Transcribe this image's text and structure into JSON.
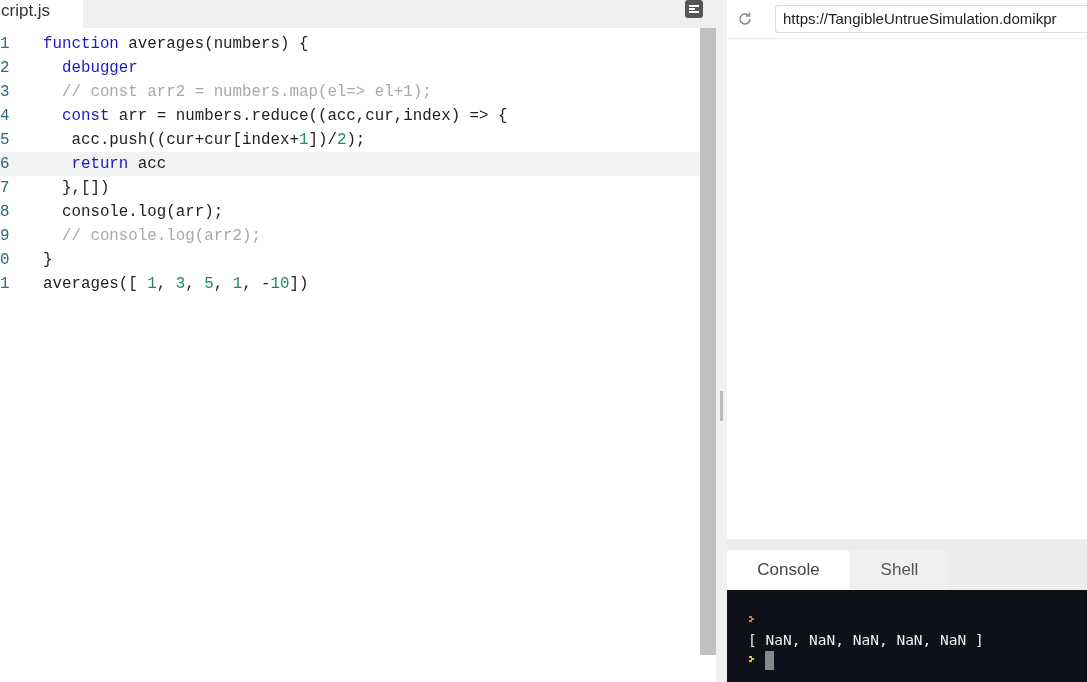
{
  "editor": {
    "tab": {
      "label": "cript.js",
      "selected": true
    },
    "lines": [
      {
        "number": "1",
        "selected": false,
        "tokens": [
          {
            "kind": "keyword",
            "text": "function"
          },
          {
            "kind": "plain",
            "text": " averages(numbers) {"
          }
        ]
      },
      {
        "number": "2",
        "selected": false,
        "tokens": [
          {
            "kind": "keyword",
            "text": "  debugger"
          }
        ]
      },
      {
        "number": "3",
        "selected": false,
        "tokens": [
          {
            "kind": "comment",
            "text": "  // const arr2 = numbers.map(el=> el+1);"
          }
        ]
      },
      {
        "number": "4",
        "selected": false,
        "tokens": [
          {
            "kind": "keyword",
            "text": "  const"
          },
          {
            "kind": "plain",
            "text": " arr = numbers.reduce((acc,cur,index) => {"
          }
        ]
      },
      {
        "number": "5",
        "selected": false,
        "tokens": [
          {
            "kind": "plain",
            "text": "   acc.push((cur+cur[index+"
          },
          {
            "kind": "number",
            "text": "1"
          },
          {
            "kind": "plain",
            "text": "])/"
          },
          {
            "kind": "number",
            "text": "2"
          },
          {
            "kind": "plain",
            "text": ");"
          }
        ]
      },
      {
        "number": "6",
        "selected": true,
        "tokens": [
          {
            "kind": "keyword",
            "text": "   return"
          },
          {
            "kind": "plain",
            "text": " acc"
          }
        ]
      },
      {
        "number": "7",
        "selected": false,
        "tokens": [
          {
            "kind": "plain",
            "text": "  },[])"
          }
        ]
      },
      {
        "number": "8",
        "selected": false,
        "tokens": [
          {
            "kind": "plain",
            "text": "  console.log(arr);"
          }
        ]
      },
      {
        "number": "9",
        "selected": false,
        "tokens": [
          {
            "kind": "comment",
            "text": "  // console.log(arr2);"
          }
        ]
      },
      {
        "number": "0",
        "selected": false,
        "tokens": [
          {
            "kind": "plain",
            "text": "}"
          }
        ]
      },
      {
        "number": "1",
        "selected": false,
        "tokens": [
          {
            "kind": "plain",
            "text": "averages([ "
          },
          {
            "kind": "number",
            "text": "1"
          },
          {
            "kind": "plain",
            "text": ", "
          },
          {
            "kind": "number",
            "text": "3"
          },
          {
            "kind": "plain",
            "text": ", "
          },
          {
            "kind": "number",
            "text": "5"
          },
          {
            "kind": "plain",
            "text": ", "
          },
          {
            "kind": "number",
            "text": "1"
          },
          {
            "kind": "plain",
            "text": ", -"
          },
          {
            "kind": "number",
            "text": "10"
          },
          {
            "kind": "plain",
            "text": "])"
          }
        ]
      }
    ]
  },
  "browser": {
    "url": "https://TangibleUntrueSimulation.domikpr"
  },
  "console": {
    "tabs": [
      {
        "label": "Console",
        "selected": true
      },
      {
        "label": "Shell",
        "selected": false
      }
    ],
    "lines": [
      {
        "kind": "prompt",
        "color": "#e8761a"
      },
      {
        "kind": "output",
        "text": "[ NaN, NaN, NaN, NaN, NaN ]"
      },
      {
        "kind": "input",
        "color": "#e8c01a"
      }
    ]
  }
}
